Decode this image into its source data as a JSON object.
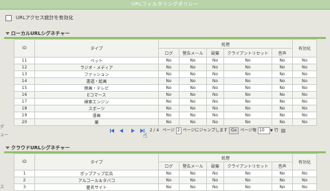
{
  "window": {
    "title": "URLフィルタリングポリシー"
  },
  "url_access": {
    "label": "URLアクセス統計を有効化"
  },
  "local_section": {
    "title": "ローカルURLシグネチャー",
    "headers": {
      "id": "ID",
      "type": "タイプ",
      "action": "処理",
      "enable": "有効化",
      "log": "ログ",
      "warn": "警告メール",
      "block": "破棄",
      "reset": "クライアントリセット",
      "sound": "音声"
    },
    "rows": [
      {
        "id": "11",
        "type": "ペット",
        "log": "No",
        "warn": "No",
        "block": "No",
        "reset": "No",
        "sound": "No",
        "enable": "No"
      },
      {
        "id": "12",
        "type": "ラジオ・メディア",
        "log": "No",
        "warn": "No",
        "block": "No",
        "reset": "No",
        "sound": "No",
        "enable": "No"
      },
      {
        "id": "13",
        "type": "ファッション",
        "log": "No",
        "warn": "No",
        "block": "No",
        "reset": "No",
        "sound": "No",
        "enable": "No"
      },
      {
        "id": "14",
        "type": "書道・絵画",
        "log": "No",
        "warn": "No",
        "block": "No",
        "reset": "No",
        "sound": "No",
        "enable": "No"
      },
      {
        "id": "15",
        "type": "映画・テレビ",
        "log": "No",
        "warn": "No",
        "block": "No",
        "reset": "No",
        "sound": "No",
        "enable": "No"
      },
      {
        "id": "16",
        "type": "Eコマース",
        "log": "No",
        "warn": "No",
        "block": "No",
        "reset": "No",
        "sound": "No",
        "enable": "No"
      },
      {
        "id": "17",
        "type": "検索エンジン",
        "log": "No",
        "warn": "No",
        "block": "No",
        "reset": "No",
        "sound": "No",
        "enable": "No"
      },
      {
        "id": "18",
        "type": "スポーツ",
        "log": "No",
        "warn": "No",
        "block": "No",
        "reset": "No",
        "sound": "No",
        "enable": "No"
      },
      {
        "id": "19",
        "type": "漫画",
        "log": "No",
        "warn": "No",
        "block": "No",
        "reset": "No",
        "sound": "No",
        "enable": "No"
      },
      {
        "id": "20",
        "type": "薬",
        "log": "No",
        "warn": "No",
        "block": "No",
        "reset": "No",
        "sound": "No",
        "enable": "No"
      }
    ]
  },
  "pager": {
    "page_info": "2 / 4",
    "page_label": "ページ",
    "page_value": "2",
    "jump_label": "ページにジャンプします",
    "go_label": "Go",
    "per_page_label": "ページ毎",
    "per_page_value": "10",
    "rows_label": "行"
  },
  "cloud_section": {
    "title": "クラウドURLシグネチャー",
    "headers": {
      "id": "ID",
      "type": "タイプ",
      "action": "処理",
      "enable": "有効化",
      "log": "ログ",
      "warn": "警告メール",
      "block": "破棄",
      "reset": "クライアントリセット",
      "sound": "音声"
    },
    "rows": [
      {
        "id": "1",
        "type": "ポップアップ広告",
        "log": "No",
        "warn": "No",
        "block": "No",
        "reset": "No",
        "sound": "No",
        "enable": "No"
      },
      {
        "id": "2",
        "type": "アルコール＆タバコ",
        "log": "No",
        "warn": "No",
        "block": "No",
        "reset": "No",
        "sound": "No",
        "enable": "No"
      },
      {
        "id": "3",
        "type": "匿名サイト",
        "log": "No",
        "warn": "No",
        "block": "No",
        "reset": "No",
        "sound": "No",
        "enable": "No"
      }
    ]
  },
  "left_fragments": [
    "グ",
    "ュー",
    "ス"
  ]
}
